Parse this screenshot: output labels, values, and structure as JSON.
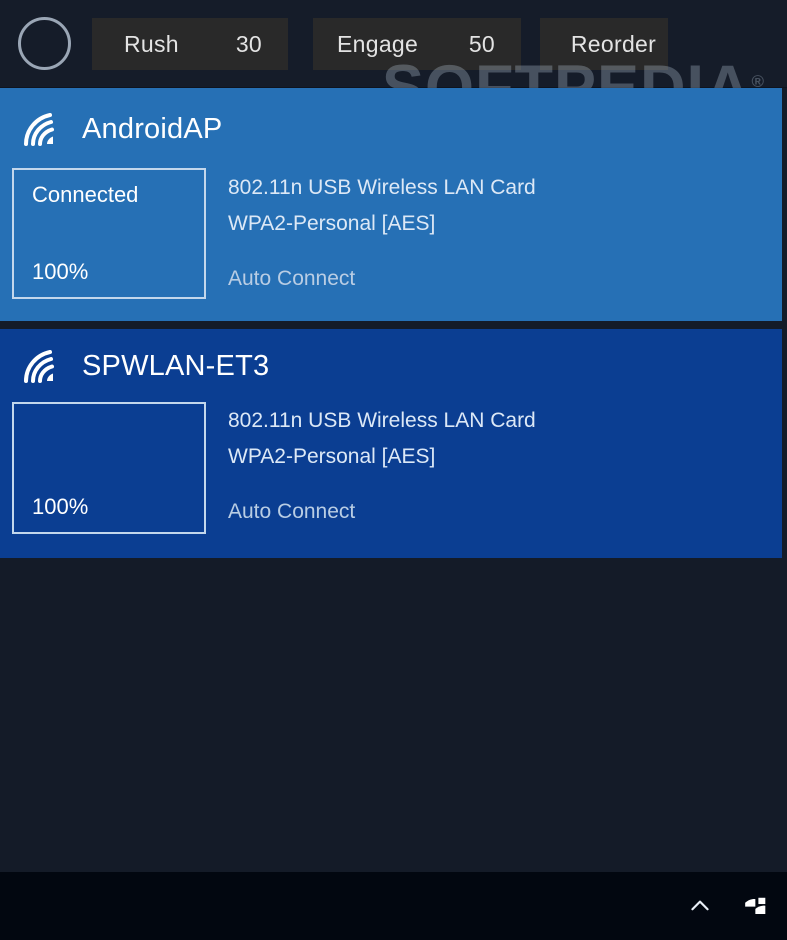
{
  "topbar": {
    "circle_icon": "circle-outline-icon",
    "buttons": [
      {
        "id": "rush",
        "label": "Rush",
        "value": "30"
      },
      {
        "id": "engage",
        "label": "Engage",
        "value": "50"
      },
      {
        "id": "reorder",
        "label": "Reorder",
        "value": ""
      }
    ]
  },
  "watermark": {
    "text": "SOFTPEDIA",
    "mark": "®"
  },
  "networks": [
    {
      "ssid": "AndroidAP",
      "icon": "wifi-signal-icon",
      "state": "Connected",
      "signal": "100%",
      "adapter": "802.11n USB Wireless LAN Card",
      "security": "WPA2-Personal [AES]",
      "auto_connect": "Auto Connect",
      "selected": true,
      "background": "#2670b5"
    },
    {
      "ssid": "SPWLAN-ET3",
      "icon": "wifi-signal-icon",
      "state": "",
      "signal": "100%",
      "adapter": "802.11n USB Wireless LAN Card",
      "security": "WPA2-Personal [AES]",
      "auto_connect": "Auto Connect",
      "selected": false,
      "background": "#0b3e92"
    }
  ],
  "taskbar": {
    "tray_icons": [
      {
        "name": "show-hidden-icons-chevron-up-icon"
      },
      {
        "name": "network-wifi-tray-icon"
      }
    ]
  },
  "colors": {
    "app_background": "#141b28",
    "topbar_background": "#151c29",
    "button_background": "#292929",
    "panel_selected": "#2670b5",
    "panel_unselected": "#0b3e92",
    "taskbar": "#020710",
    "box_border": "#c3d7ec"
  }
}
